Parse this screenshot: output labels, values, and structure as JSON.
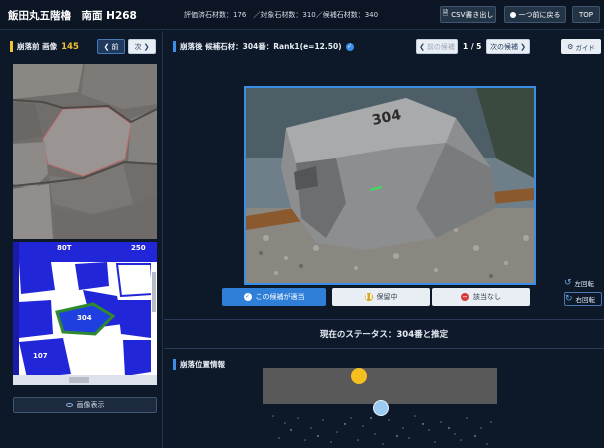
{
  "header": {
    "title": "飯田丸五階櫓　南面 H268",
    "stats": "評価済石材数：176　／対象石材数：310／候補石材数：340",
    "csv_label": "CSV書き出し",
    "back_label": "一つ前に戻る",
    "top_label": "TOP"
  },
  "left_panel": {
    "title_prefix": "崩落前 画像",
    "stone_number": "145",
    "prev_label": "前",
    "next_label": "次",
    "segment_labels": [
      "80T",
      "250",
      "304",
      "107"
    ],
    "toggle_label": "画像表示"
  },
  "right_panel": {
    "title": "崩落後 候補石材：304番：Rank1(e=12.50)",
    "prev_candidate_label": "前の候補",
    "page_indicator": "1 / 5",
    "next_candidate_label": "次の候補",
    "guide_label": "ガイド",
    "stone_marking": "304",
    "rotate_left_label": "左回転",
    "rotate_right_label": "右回転",
    "actions": {
      "confirm_label": "この候補が適当",
      "hold_label": "保留中",
      "reject_label": "該当なし"
    },
    "status_text": "現在のステータス：304番と推定",
    "position_title": "崩落位置情報"
  },
  "colors": {
    "accent_blue": "#3a8ee6",
    "confirm_blue": "#2f7fd9",
    "marker_yellow": "#f4c020",
    "marker_lightblue": "#9ccbf2",
    "segment_blue": "#1f23d9",
    "segment_green": "#27802e"
  },
  "icons": [
    "file-icon",
    "circle-back-icon",
    "chevron-left-icon",
    "chevron-right-icon",
    "check-circle-icon",
    "gear-icon",
    "eye-icon",
    "rotate-left-icon",
    "rotate-right-icon",
    "pause-icon",
    "minus-circle-icon",
    "verified-icon"
  ]
}
